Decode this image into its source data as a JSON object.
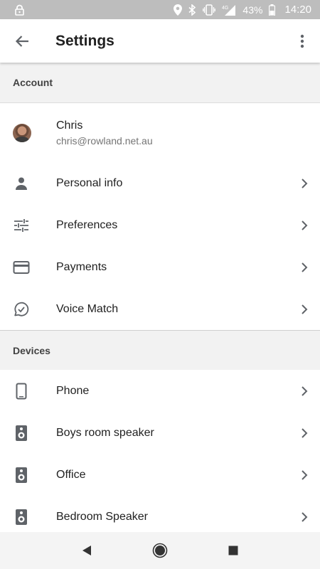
{
  "status_bar": {
    "battery_percent": "43%",
    "time": "14:20",
    "network": "4G"
  },
  "app_bar": {
    "title": "Settings"
  },
  "sections": {
    "account": "Account",
    "devices": "Devices"
  },
  "account": {
    "name": "Chris",
    "email": "chris@rowland.net.au"
  },
  "account_items": [
    {
      "label": "Personal info",
      "icon": "person-icon"
    },
    {
      "label": "Preferences",
      "icon": "tune-icon"
    },
    {
      "label": "Payments",
      "icon": "credit-card-icon"
    },
    {
      "label": "Voice Match",
      "icon": "voice-match-icon"
    }
  ],
  "device_items": [
    {
      "label": "Phone",
      "icon": "phone-icon"
    },
    {
      "label": "Boys room speaker",
      "icon": "speaker-icon"
    },
    {
      "label": "Office",
      "icon": "speaker-icon"
    },
    {
      "label": "Bedroom Speaker",
      "icon": "speaker-icon"
    }
  ],
  "colors": {
    "status_bar": "#bdbdbd",
    "section_bg": "#f2f2f2",
    "icon_gray": "#5f6368",
    "text_primary": "#212121",
    "text_secondary": "#757575"
  }
}
